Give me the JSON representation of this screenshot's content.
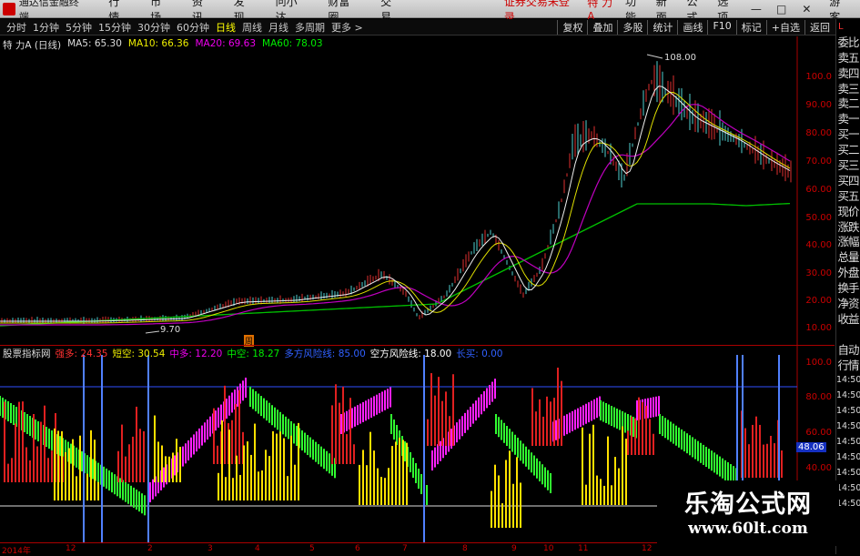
{
  "titlebar": {
    "app": "通达信金融终端",
    "menus": [
      "行情",
      "市场",
      "资讯",
      "发现",
      "问小达",
      "财富圈",
      "交易"
    ],
    "broker_status": "证券交易未登录",
    "stock": "特 力A",
    "right_menus": [
      "功能",
      "新面",
      "公式",
      "选项"
    ],
    "guest": "游客",
    "window_buttons": [
      "—",
      "□",
      "✕"
    ]
  },
  "periods": [
    "分时",
    "1分钟",
    "5分钟",
    "15分钟",
    "30分钟",
    "60分钟",
    "日线",
    "周线",
    "月线",
    "多周期",
    "更多 >"
  ],
  "active_period": "日线",
  "toolbar_right": [
    "复权",
    "叠加",
    "多股",
    "统计",
    "画线",
    "F10",
    "标记",
    "+自选",
    "返回"
  ],
  "main": {
    "title": "特 力A (日线)",
    "ma": [
      {
        "label": "MA5: 65.30",
        "color": "#ffffff"
      },
      {
        "label": "MA10: 66.36",
        "color": "#ffff00"
      },
      {
        "label": "MA20: 69.63",
        "color": "#ff00ff"
      },
      {
        "label": "MA60: 78.03",
        "color": "#00ff00"
      }
    ],
    "high_label": "108.00",
    "low_label": "9.70",
    "marker": "周"
  },
  "price_axis": [
    "100.0",
    "90.00",
    "80.00",
    "70.00",
    "60.00",
    "50.00",
    "40.00",
    "30.00",
    "20.00",
    "10.00"
  ],
  "indicator": {
    "title": "股票指标网",
    "items": [
      {
        "label": "强多:",
        "value": "24.35",
        "color": "#ff3030"
      },
      {
        "label": "短空:",
        "value": "30.54",
        "color": "#ffff00"
      },
      {
        "label": "中多:",
        "value": "12.20",
        "color": "#ff00ff"
      },
      {
        "label": "中空:",
        "value": "18.27",
        "color": "#00ff00"
      },
      {
        "label": "多方风险线:",
        "value": "85.00",
        "color": "#3060ff"
      },
      {
        "label": "空方风险线:",
        "value": "18.00",
        "color": "#ffffff"
      },
      {
        "label": "长买:",
        "value": "0.00",
        "color": "#3060ff"
      }
    ],
    "current_value": "48.06"
  },
  "ind_axis": [
    "100.0",
    "80.00",
    "60.00",
    "40.00"
  ],
  "side_panel": [
    "L",
    "委比",
    "卖五",
    "卖四",
    "卖三",
    "卖二",
    "卖一",
    "买一",
    "买二",
    "买三",
    "买四",
    "买五",
    "现价",
    "涨跌",
    "涨幅",
    "总量",
    "外盘",
    "换手",
    "净资",
    "收益",
    "",
    "自动",
    "行情",
    "14:50",
    "14:50",
    "14:50",
    "14:50",
    "14:50",
    "14:50",
    "14:50",
    "14:50",
    "14:50"
  ],
  "date_axis": [
    "2014年",
    "12",
    "2",
    "3",
    "4",
    "5",
    "6",
    "7",
    "8",
    "9",
    "10",
    "11",
    "12"
  ],
  "watermark": {
    "line1": "乐淘公式网",
    "line2": "www.60lt.com"
  }
}
